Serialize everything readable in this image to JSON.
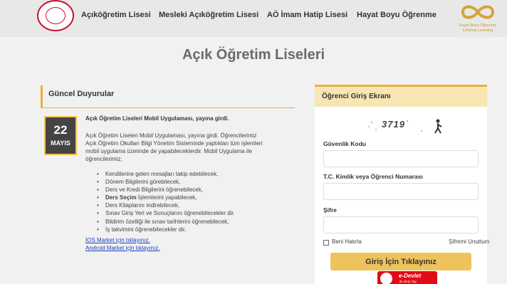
{
  "header": {
    "nav": [
      "Açıköğretim Lisesi",
      "Mesleki Açıköğretim Lisesi",
      "AÖ İmam Hatip Lisesi",
      "Hayat Boyu Öğrenme"
    ],
    "brand_caption_1": "Hayat Boyu Öğrenme",
    "brand_caption_2": "Lifelong Learning"
  },
  "page_title": "Açık Öğretim Liseleri",
  "news": {
    "heading": "Güncel Duyurular",
    "date_day": "22",
    "date_month": "MAYIS",
    "title": "Açık Öğretim Liseleri Mobil Uygulaması, yayına girdi.",
    "body_lines": [
      "Açık Öğretim Liseleri Mobil Uygulaması, yayına girdi. Öğrencilerimiz",
      "Açık Öğretim Okulları Bilgi Yönetim Sisteminde yaptıkları tüm işlemleri",
      "mobil uygulama üzerinde de yapabileceklerdir. Mobil Uygulama ile",
      "öğrencilerimiz;"
    ],
    "bullets": [
      {
        "strong": "",
        "text": "Kendilerine gelen mesajları takip edebilecek,"
      },
      {
        "strong": "",
        "text": "Dönem Bilgilerini görebilecek,"
      },
      {
        "strong": "",
        "text": "Ders ve Kredi Bilgilerini öğrenebilecek,"
      },
      {
        "strong": "Ders Seçim",
        "text": " İşlemlerini yapabilecek,"
      },
      {
        "strong": "",
        "text": "Ders Kitaplarını indirebilecek,"
      },
      {
        "strong": "",
        "text": "Sınav Giriş Yeri ve Sonuçlarını öğrenebilecekler dir."
      },
      {
        "strong": "",
        "text": "Bildirim özelliği ile sınav tarihlerini öğrenebilecek,"
      },
      {
        "strong": "",
        "text": "İş takvimini öğrenebilecekler dir."
      }
    ],
    "ios_link": "İOS Market için tıklayınız.",
    "android_link": "Android Market için tıklayınız."
  },
  "login": {
    "heading": "Öğrenci Giriş Ekranı",
    "captcha_text": "3719",
    "security_code_label": "Güvenlik Kodu",
    "id_label": "T.C. Kimlik veya Öğrenci Numarası",
    "password_label": "Şifre",
    "remember_label": "Beni Hatırla",
    "forgot_label": "Şifremi Unuttum",
    "submit_label": "Giriş İçin Tıklayınız",
    "edevlet_title": "e-Devlet",
    "edevlet_subtitle": "ile Giriş Yap"
  },
  "colors": {
    "accent": "#e8b03e",
    "button": "#eec35c",
    "edevlet": "#e30a17",
    "date_box": "#444444"
  }
}
